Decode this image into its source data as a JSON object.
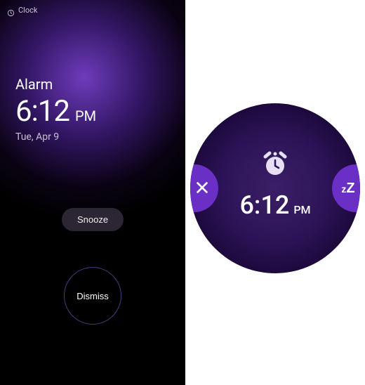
{
  "status": {
    "app_name": "Clock"
  },
  "alarm": {
    "label": "Alarm",
    "time": "6:12",
    "ampm": "PM",
    "date": "Tue, Apr 9",
    "snooze_label": "Snooze",
    "dismiss_label": "Dismiss"
  },
  "watch": {
    "time": "6:12",
    "ampm": "PM"
  }
}
